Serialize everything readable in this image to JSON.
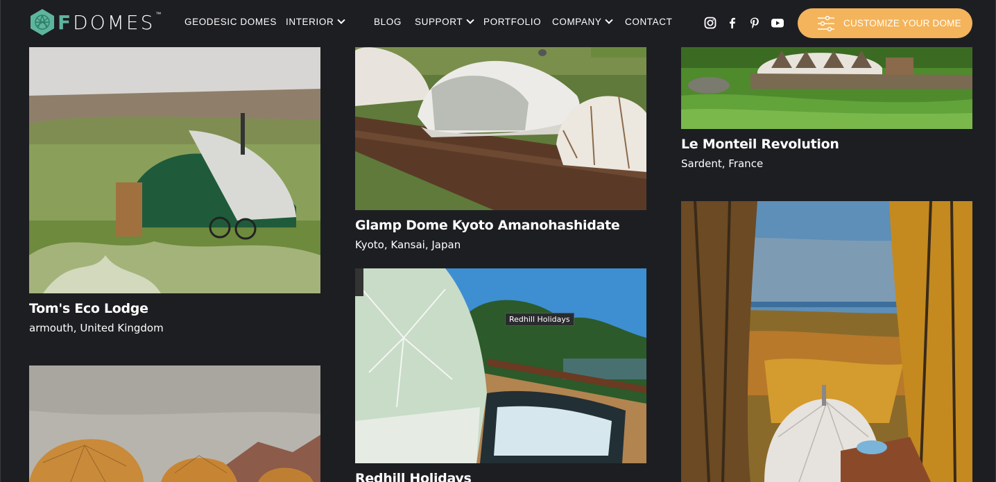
{
  "brand": {
    "logo_text": "DOMES",
    "logo_letter": "F",
    "tm": "™"
  },
  "nav": {
    "geodesic": "GEODESIC DOMES",
    "interior": "INTERIOR",
    "blog": "BLOG",
    "support": "SUPPORT",
    "portfolio": "PORTFOLIO",
    "company": "COMPANY",
    "contact": "CONTACT"
  },
  "social": [
    "instagram-icon",
    "facebook-icon",
    "pinterest-icon",
    "youtube-icon"
  ],
  "cta": {
    "label": "CUSTOMIZE YOUR DOME",
    "color": "#f4b45b"
  },
  "cards": [
    {
      "title": "Tom's Eco Lodge",
      "location": "armouth, United Kingdom"
    },
    {
      "title": "Glamp Dome Kyoto Amanohashidate",
      "location": "Kyoto, Kansai, Japan"
    },
    {
      "title": "Le Monteil Revolution",
      "location": "Sardent, France"
    },
    {
      "title": "Redhill Holidays",
      "location": ""
    }
  ],
  "tooltip": "Redhill Holidays",
  "colors": {
    "background": "#1d1e22",
    "accent": "#f4b45b",
    "logo": "#5eb59e"
  }
}
